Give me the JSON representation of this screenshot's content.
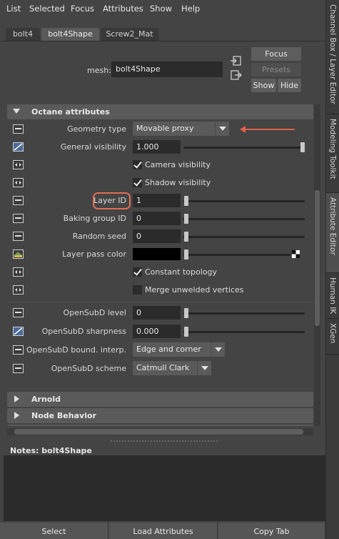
{
  "menu": [
    "List",
    "Selected",
    "Focus",
    "Attributes",
    "Show",
    "Help"
  ],
  "node_tabs": [
    "bolt4",
    "bolt4Shape",
    "Screw2_Mat"
  ],
  "right_tabs": [
    "Channel Box / Layer Editor",
    "Modeling Toolkit",
    "Attribute Editor",
    "Human IK",
    "XGen"
  ],
  "header": {
    "mesh_label": "mesh:",
    "mesh_value": "bolt4Shape",
    "focus": "Focus",
    "presets": "Presets",
    "show": "Show",
    "hide": "Hide"
  },
  "section_octane": "Octane attributes",
  "rows": {
    "geometry_type_label": "Geometry type",
    "geometry_type_value": "Movable proxy",
    "general_visibility_label": "General visibility",
    "general_visibility_value": "1.000",
    "camera_visibility": "Camera visibility",
    "shadow_visibility": "Shadow visibility",
    "layer_id_label": "Layer ID",
    "layer_id_value": "1",
    "baking_group_label": "Baking group ID",
    "baking_group_value": "0",
    "random_seed_label": "Random seed",
    "random_seed_value": "0",
    "layer_pass_color_label": "Layer pass color",
    "constant_topology": "Constant topology",
    "merge_unwelded": "Merge unwelded vertices",
    "opensubd_level_label": "OpenSubD level",
    "opensubd_level_value": "0",
    "opensubd_sharpness_label": "OpenSubD sharpness",
    "opensubd_sharpness_value": "0.000",
    "opensubd_bound_label": "OpenSubD bound. interp.",
    "opensubd_bound_value": "Edge and corner",
    "opensubd_scheme_label": "OpenSubD scheme",
    "opensubd_scheme_value": "Catmull Clark"
  },
  "section_arnold": "Arnold",
  "section_node_behavior": "Node Behavior",
  "notes_label": "Notes:  bolt4Shape",
  "bottom_buttons": [
    "Select",
    "Load Attributes",
    "Copy Tab"
  ],
  "colors": {
    "highlight": "#e07054",
    "field_bg": "#2b2b2b",
    "panel_bg": "#444444"
  }
}
